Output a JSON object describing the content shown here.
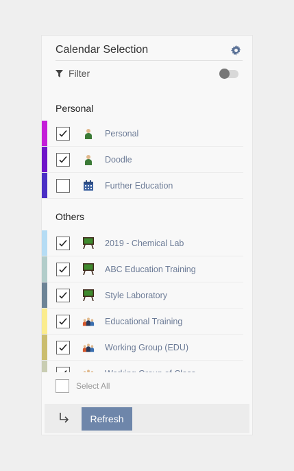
{
  "panel": {
    "title": "Calendar Selection",
    "filter_label": "Filter",
    "filter_enabled": false
  },
  "personal": {
    "heading": "Personal",
    "items": [
      {
        "label": "Personal",
        "checked": true,
        "color": "#c41ed8",
        "icon": "person-icon"
      },
      {
        "label": "Doodle",
        "checked": true,
        "color": "#6f14c9",
        "icon": "person-icon"
      },
      {
        "label": "Further Education",
        "checked": false,
        "color": "#4a2fc5",
        "icon": "calendar-icon"
      }
    ]
  },
  "others": {
    "heading": "Others",
    "items": [
      {
        "label": "2019 - Chemical Lab",
        "checked": true,
        "color": "#b5dcf4",
        "icon": "whiteboard-icon"
      },
      {
        "label": "ABC Education Training",
        "checked": true,
        "color": "#b2cdca",
        "icon": "whiteboard-icon"
      },
      {
        "label": "Style Laboratory",
        "checked": true,
        "color": "#6d8496",
        "icon": "whiteboard-icon"
      },
      {
        "label": "Educational Training",
        "checked": true,
        "color": "#fbec8d",
        "icon": "group-icon"
      },
      {
        "label": "Working Group (EDU)",
        "checked": true,
        "color": "#cbbd6e",
        "icon": "group-icon"
      },
      {
        "label": "Working Group of Class",
        "checked": true,
        "color": "#c9cdb2",
        "icon": "group-icon"
      }
    ]
  },
  "select_all": {
    "label": "Select All",
    "checked": false
  },
  "footer": {
    "refresh_label": "Refresh"
  }
}
